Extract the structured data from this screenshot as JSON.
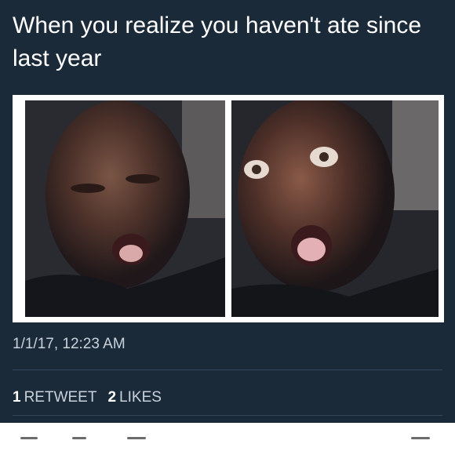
{
  "tweet": {
    "text": "When you realize you haven't ate since last year",
    "timestamp": "1/1/17, 12:23 AM",
    "stats": {
      "retweets": {
        "count": "1",
        "label": "RETWEET"
      },
      "likes": {
        "count": "2",
        "label": "LIKES"
      }
    }
  },
  "media": {
    "left_photo": "man-squinting-photo",
    "right_photo": "man-surprised-photo"
  },
  "actions": [
    "reply-icon",
    "retweet-icon",
    "like-icon",
    "share-icon"
  ],
  "colors": {
    "background": "#1b2a38",
    "text": "#ffffff",
    "secondary_text": "#c9d2db",
    "divider": "#33475a",
    "action_bar": "#ffffff"
  }
}
